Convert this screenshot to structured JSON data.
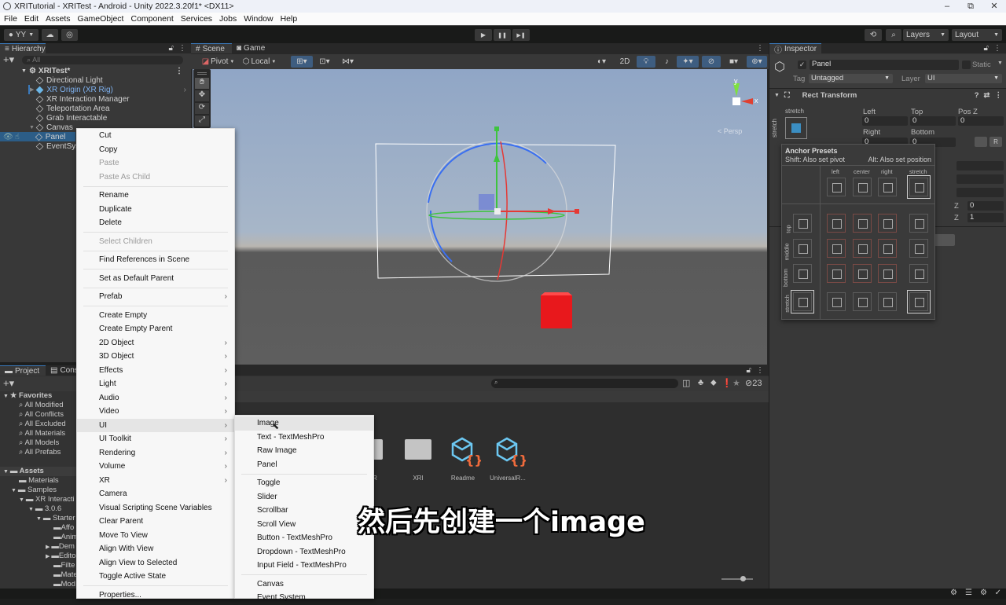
{
  "window": {
    "title": "XRITutorial - XRITest - Android - Unity 2022.3.20f1* <DX11>",
    "controls": {
      "minimize": "–",
      "maximize": "⧉",
      "close": "✕"
    }
  },
  "menubar": [
    "File",
    "Edit",
    "Assets",
    "GameObject",
    "Component",
    "Services",
    "Jobs",
    "Window",
    "Help"
  ],
  "toolbar": {
    "account": "YY",
    "play": "▶",
    "pause": "❚❚",
    "step": "▶❚",
    "layers": "Layers",
    "layout": "Layout"
  },
  "hierarchy": {
    "tab": "Hierarchy",
    "search_placeholder": "All",
    "scene": "XRITest*",
    "items": [
      {
        "label": "Directional Light",
        "depth": 1
      },
      {
        "label": "XR Origin (XR Rig)",
        "depth": 1,
        "prefab": true
      },
      {
        "label": "XR Interaction Manager",
        "depth": 1
      },
      {
        "label": "Teleportation Area",
        "depth": 1
      },
      {
        "label": "Grab Interactable",
        "depth": 1
      },
      {
        "label": "Canvas",
        "depth": 1
      },
      {
        "label": "Panel",
        "depth": 2,
        "selected": true
      },
      {
        "label": "EventSystem",
        "depth": 1
      }
    ]
  },
  "scene": {
    "tabs": [
      "Scene",
      "Game"
    ],
    "pivot": "Pivot",
    "local": "Local",
    "mode_2d": "2D",
    "gizmo_x": "x",
    "gizmo_y": "y",
    "persp": "< Persp"
  },
  "context_menu": {
    "items": [
      {
        "label": "Cut"
      },
      {
        "label": "Copy"
      },
      {
        "label": "Paste",
        "disabled": true
      },
      {
        "label": "Paste As Child",
        "disabled": true
      },
      {
        "sep": true
      },
      {
        "label": "Rename"
      },
      {
        "label": "Duplicate"
      },
      {
        "label": "Delete"
      },
      {
        "sep": true
      },
      {
        "label": "Select Children",
        "disabled": true
      },
      {
        "sep": true
      },
      {
        "label": "Find References in Scene"
      },
      {
        "sep": true
      },
      {
        "label": "Set as Default Parent"
      },
      {
        "sep": true
      },
      {
        "label": "Prefab",
        "sub": true
      },
      {
        "sep": true
      },
      {
        "label": "Create Empty"
      },
      {
        "label": "Create Empty Parent"
      },
      {
        "label": "2D Object",
        "sub": true
      },
      {
        "label": "3D Object",
        "sub": true
      },
      {
        "label": "Effects",
        "sub": true
      },
      {
        "label": "Light",
        "sub": true
      },
      {
        "label": "Audio",
        "sub": true
      },
      {
        "label": "Video",
        "sub": true
      },
      {
        "label": "UI",
        "sub": true,
        "highlight": true
      },
      {
        "label": "UI Toolkit",
        "sub": true
      },
      {
        "label": "Rendering",
        "sub": true
      },
      {
        "label": "Volume",
        "sub": true
      },
      {
        "label": "XR",
        "sub": true
      },
      {
        "label": "Camera"
      },
      {
        "label": "Visual Scripting Scene Variables"
      },
      {
        "label": "Clear Parent"
      },
      {
        "label": "Move To View"
      },
      {
        "label": "Align With View"
      },
      {
        "label": "Align View to Selected"
      },
      {
        "label": "Toggle Active State"
      },
      {
        "sep": true
      },
      {
        "label": "Properties..."
      }
    ]
  },
  "ui_submenu": {
    "items": [
      {
        "label": "Image",
        "highlight": true
      },
      {
        "label": "Text - TextMeshPro"
      },
      {
        "label": "Raw Image"
      },
      {
        "label": "Panel"
      },
      {
        "sep": true
      },
      {
        "label": "Toggle"
      },
      {
        "label": "Slider"
      },
      {
        "label": "Scrollbar"
      },
      {
        "label": "Scroll View"
      },
      {
        "label": "Button - TextMeshPro"
      },
      {
        "label": "Dropdown - TextMeshPro"
      },
      {
        "label": "Input Field - TextMeshPro"
      },
      {
        "sep": true
      },
      {
        "label": "Canvas"
      },
      {
        "label": "Event System"
      }
    ]
  },
  "project": {
    "tabs": [
      "Project",
      "Console"
    ],
    "favorites_label": "Favorites",
    "favorites": [
      "All Modified",
      "All Conflicts",
      "All Excluded",
      "All Materials",
      "All Models",
      "All Prefabs"
    ],
    "assets_label": "Assets",
    "tree": [
      {
        "label": "Materials",
        "depth": 1
      },
      {
        "label": "Samples",
        "depth": 1
      },
      {
        "label": "XR Interacti",
        "depth": 2
      },
      {
        "label": "3.0.6",
        "depth": 3
      },
      {
        "label": "Starter",
        "depth": 4
      },
      {
        "label": "Affo",
        "depth": 5
      },
      {
        "label": "Anim",
        "depth": 5
      },
      {
        "label": "Dem",
        "depth": 5
      },
      {
        "label": "Edito",
        "depth": 5
      },
      {
        "label": "Filte",
        "depth": 5
      },
      {
        "label": "Mate",
        "depth": 5
      },
      {
        "label": "Mod",
        "depth": 5
      }
    ],
    "hidden_count": "23",
    "grid_items": [
      "R",
      "XRI",
      "Readme",
      "UniversalR..."
    ]
  },
  "inspector": {
    "tab": "Inspector",
    "object_name": "Panel",
    "active": true,
    "static_label": "Static",
    "tag_label": "Tag",
    "tag_value": "Untagged",
    "layer_label": "Layer",
    "layer_value": "UI",
    "rect_transform": {
      "title": "Rect Transform",
      "anchor_h": "stretch",
      "anchor_v": "stretch",
      "left_label": "Left",
      "left": "0",
      "top_label": "Top",
      "top": "0",
      "posz_label": "Pos Z",
      "posz": "0",
      "right_label": "Right",
      "right": "0",
      "bottom_label": "Bottom",
      "bottom": "0",
      "scale_z0_label": "Z",
      "scale_z0": "0",
      "scale_z1_label": "Z",
      "scale_z1": "1",
      "r_button": "R"
    },
    "anchor_presets": {
      "title": "Anchor Presets",
      "shift_hint": "Shift: Also set pivot",
      "alt_hint": "Alt: Also set position",
      "columns": [
        "left",
        "center",
        "right",
        "stretch"
      ],
      "rows": [
        "top",
        "middle",
        "bottom",
        "stretch"
      ]
    }
  },
  "subtitle": "然后先创建一个image"
}
